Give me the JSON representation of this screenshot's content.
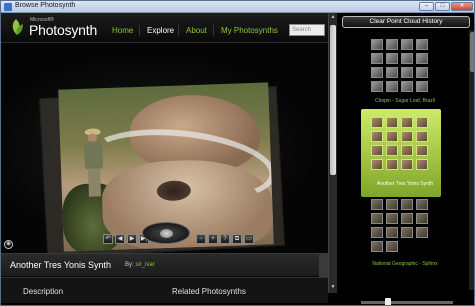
{
  "window": {
    "title": "Browse Photosynth",
    "controls": {
      "minimize": "–",
      "maximize": "□",
      "close": "✕"
    }
  },
  "header": {
    "brand_small": "Microsoft®",
    "brand": "Photosynth",
    "nav": [
      "Home",
      "Explore",
      "About",
      "My Photosynths"
    ],
    "active_nav": "Explore",
    "search_placeholder": "Search"
  },
  "viewer": {
    "controls": [
      "↶",
      "◀",
      "▶",
      "▶|"
    ],
    "zoom_controls": [
      "−",
      "+",
      "?",
      "⧉",
      "▭"
    ],
    "ring_button": "◉"
  },
  "synth": {
    "title": "Another Tres Yonis Synth",
    "by_label": "By:",
    "author": "sir_ivar"
  },
  "bottom_tabs": [
    "Description",
    "Related Photosynths"
  ],
  "right_panel": {
    "clear_button": "Clear Point Cloud History",
    "collections": [
      {
        "label": "Chopin - Sugar Loaf, Brazil",
        "selected": false
      },
      {
        "label": "Another Tres Yonis Synth",
        "selected": true
      },
      {
        "label": "National Geographic - Sphinx",
        "selected": false
      }
    ]
  },
  "colors": {
    "accent_green": "#8cc63f",
    "background": "#000000"
  }
}
